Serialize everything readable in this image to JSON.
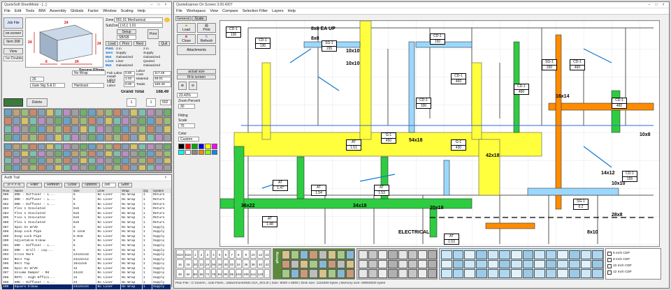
{
  "left_window": {
    "title": "QuoteSoft SheetMetal - [...]",
    "menu": [
      "File",
      "Edit",
      "Tools",
      "BIM",
      "Assembly",
      "Globals",
      "Factor",
      "Window",
      "Scaling",
      "Help"
    ],
    "side_buttons": [
      "Job File",
      "on-screen",
      "Item 398"
    ],
    "view_label": "View",
    "iso_label": "Iso Double",
    "dims": {
      "top": "24",
      "left": "24",
      "right": "24",
      "front": "24",
      "bottom": "24",
      "depth": "6"
    },
    "fitting_name": "Square Elbow",
    "zone_label": "Zone",
    "zone_value": "001.01 Mechanical",
    "subzone_label": "SubZone",
    "subzone_value": "LVL1 1.01",
    "setup_label": "Setup",
    "setup_value": "SB/SB",
    "load_btn": "Load",
    "prev_btn": "Prev",
    "next_btn": "Next",
    "print_btn": "Print",
    "quit_btn": "Quit",
    "specs": [
      {
        "k": "PWG",
        "v": "2 in",
        "v2": "2 in"
      },
      {
        "k": "Serv",
        "v": "Supply",
        "v2": "Supply"
      },
      {
        "k": "Mat",
        "v": "Galvanized",
        "v2": "Galvanized"
      },
      {
        "k": "Liner",
        "v": "Liner",
        "v2": "Quoted"
      },
      {
        "k": "Mat",
        "v": "Galvanized",
        "v2": "Galvanized"
      }
    ],
    "wrap_label": "No Wrap",
    "ductgauge_label": "Gauge",
    "gauge_value": "26",
    "conn_value": "Galv Stg S & D",
    "sealant_value": "Hardcast",
    "costs": [
      {
        "k": "Fab Labor",
        "v": "0.60",
        "k2": "Labor Cost",
        "v2": "117.48"
      },
      {
        "k": "Install Labor",
        "v": "1.04",
        "k2": "Material",
        "v2": "49.01"
      },
      {
        "k": "Other Labor",
        "v": "0.00",
        "k2": "Totals",
        "v2": "168.49"
      }
    ],
    "grand_total_label": "Grand Total",
    "grand_total_value": "168.49",
    "delete_btn": "Delete",
    "qty_value": "1",
    "qty2_value": "1",
    "count_value": "502"
  },
  "audit": {
    "title": "Audit Trail",
    "filter_btn": "Filter",
    "refresh_btn": "Refresh",
    "close_btn": "Close",
    "options_btn": "Options",
    "page_value": "398",
    "goto_btn": "Goto",
    "columns": [
      "Row",
      "Name",
      "Size",
      "Liner",
      "Wrap",
      "Qty",
      "System"
    ],
    "rows": [
      [
        "380",
        "GRD - Diffuser - L...",
        "6",
        "No Liner",
        "No Wrap",
        "1",
        "Return"
      ],
      [
        "381",
        "GRD - Diffuser - L...",
        "6",
        "No Liner",
        "No Wrap",
        "1",
        "Return"
      ],
      [
        "382",
        "GRD - Diffuser - L...",
        "6",
        "No Liner",
        "No Wrap",
        "1",
        "Return"
      ],
      [
        "383",
        "Flex 1 Insulated",
        "6x6",
        "No Liner",
        "No Wrap",
        "1",
        "Return"
      ],
      [
        "384",
        "Flex 1 Insulated",
        "6x6",
        "No Liner",
        "No Wrap",
        "1",
        "Return"
      ],
      [
        "385",
        "Flex 1 Insulated",
        "6x6",
        "No Liner",
        "No Wrap",
        "1",
        "Return"
      ],
      [
        "386",
        "Flex 1 Insulated",
        "6x6",
        "No Liner",
        "No Wrap",
        "1",
        "Return"
      ],
      [
        "387",
        "Spin In W/VD",
        "6",
        "No Liner",
        "No Wrap",
        "1",
        "Supply"
      ],
      [
        "388",
        "Snap Lock Pipe",
        "6 x2x8",
        "No Liner",
        "No Wrap",
        "1",
        "Supply"
      ],
      [
        "389",
        "Snap Lock Pipe",
        "6.0x8",
        "No Liner",
        "No Wrap",
        "1",
        "Supply"
      ],
      [
        "390",
        "Adjustable Elbow",
        "6",
        "No Liner",
        "No Wrap",
        "1",
        "Supply"
      ],
      [
        "391",
        "GRD - Diffuser - L...",
        "6",
        "No Liner",
        "No Wrap",
        "1",
        "Supply"
      ],
      [
        "392",
        "GRD - Grill - Lay...",
        "6",
        "No Liner",
        "No Wrap",
        "1",
        "Supply"
      ],
      [
        "393",
        "Cross Mark",
        "24x24x18",
        "No Liner",
        "No Wrap",
        "1",
        "Supply"
      ],
      [
        "394",
        "Rect Tap",
        "24x24x12",
        "No Liner",
        "No Wrap",
        "1",
        "Supply"
      ],
      [
        "395",
        "Rect Tap",
        "16x14x6",
        "No Liner",
        "No Wrap",
        "1",
        "Supply"
      ],
      [
        "396",
        "Spin In W/VD",
        "12",
        "No Liner",
        "No Wrap",
        "1",
        "Supply"
      ],
      [
        "397",
        "Volume Damper - Rd",
        "24x24",
        "No Liner",
        "No Wrap",
        "1",
        "Supply"
      ],
      [
        "398",
        "MSTC - High Effici...",
        "12",
        "No Liner",
        "No Wrap",
        "1",
        "Supply"
      ],
      [
        "399",
        "GRD - Diffuser - L...",
        "24",
        "No Liner",
        "No Wrap",
        "1",
        "Supply"
      ],
      [
        "400",
        "Square Elbow",
        "24x24x24",
        "No Liner",
        "No Wrap",
        "1",
        "Supply"
      ]
    ]
  },
  "right_window": {
    "title": "QuoteExpress On Screen 3.00.4207",
    "menu": [
      "File",
      "Workspace",
      "View",
      "Compare",
      "Selection Filter",
      "Layers",
      "Help"
    ],
    "tabs": [
      "General",
      "Scale"
    ],
    "tools": [
      "Load",
      "Print",
      "Close",
      "Refresh",
      "Attachments"
    ],
    "zoom_labels": [
      "actual size",
      "fit to screen"
    ],
    "zoom_value": "23.43%",
    "zoom_percent_label": "Zoom Percent",
    "zoom_percent_value": "30",
    "fitting_label": "Fitting",
    "scale_label": "Scale",
    "scale_value": "75",
    "color_label": "Color",
    "custom_label": "Custom",
    "status": "Plan File : C:\\Users\\...\\Job Files\\...\\attachments\\M1.01A_001.tif | Size: 9000 x 6500 | Disk size: 1116260 bytes | Memory size: 69050000 bytes",
    "drawing_labels": [
      {
        "t": "8x8 EA UP"
      },
      {
        "t": "8x8"
      },
      {
        "t": "10x10"
      },
      {
        "t": "10x10"
      },
      {
        "t": "16x14"
      },
      {
        "t": "10x14"
      },
      {
        "t": "54x18"
      },
      {
        "t": "42x18"
      },
      {
        "t": "34x18"
      },
      {
        "t": "20x18"
      },
      {
        "t": "36x22"
      },
      {
        "t": "14x12"
      },
      {
        "t": "8x10"
      },
      {
        "t": "10x10"
      },
      {
        "t": "28x8"
      },
      {
        "t": "ELECTRICAL"
      },
      {
        "t": "10x8"
      }
    ],
    "tag_labels": [
      "CD-1",
      "CD-1",
      "SG-1",
      "CD-1",
      "CD-1",
      "SG-1",
      "CD-1",
      "CD-1",
      "G-1",
      "G-1",
      "AT",
      "AT",
      "AT",
      "AT",
      "AT",
      "CD-1",
      "CD-1",
      "SG-1",
      "CD-1",
      "AT"
    ],
    "tag_values": [
      "130",
      "130",
      "155",
      "150",
      "460",
      "330",
      "460",
      "460",
      "450",
      "430",
      "1.51",
      "1.54",
      "1.47",
      "1.53",
      "1.48",
      "460",
      "330",
      "6.2",
      "155",
      "1.53"
    ]
  },
  "palette": {
    "sizes_a": [
      "Size",
      "Size",
      "1",
      "2",
      "3",
      "4",
      "5",
      "6",
      "7",
      "8",
      "9",
      "10",
      "12",
      "14"
    ],
    "sizes_b": [
      "16",
      "18",
      "20",
      "22",
      "24",
      "26",
      "28",
      "30",
      "32",
      "34",
      "36",
      "38",
      "40",
      "42"
    ],
    "sizes_c": [
      "48",
      "54",
      "60",
      "66",
      "72",
      "78",
      "84",
      "90",
      "96",
      "102",
      "108",
      "114",
      "120",
      "..."
    ],
    "legend": [
      "6 Inch CDF",
      "8 Inch CDF",
      "10 Inch CDF",
      "12 Inch CDF"
    ],
    "accept_label": "Accept"
  },
  "colors": {
    "yellow": "#ffff3d",
    "green": "#2ecc40",
    "orange": "#ff8c00",
    "blue": "#4aa3ff",
    "cyan": "#00e5ff"
  }
}
